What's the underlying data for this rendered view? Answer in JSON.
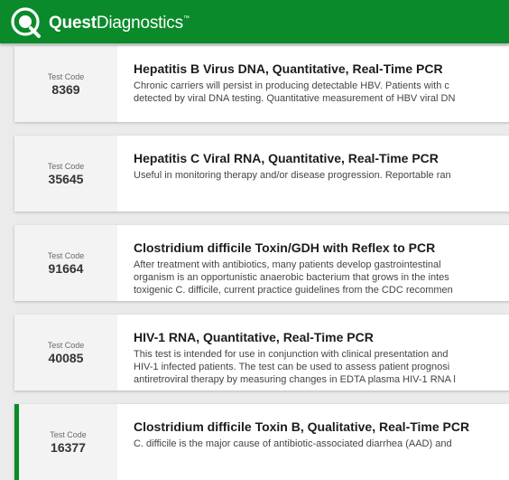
{
  "header": {
    "brand_bold": "Quest",
    "brand_light": "Diagnostics",
    "trademark": "™",
    "bg_color": "#0a8a2a"
  },
  "tests": [
    {
      "code_label": "Test Code",
      "code": "8369",
      "title": "Hepatitis B Virus DNA, Quantitative, Real-Time PCR",
      "desc_lines": [
        "Chronic carriers will persist in producing detectable HBV. Patients with c",
        "detected by viral DNA testing. Quantitative measurement of HBV viral DN"
      ]
    },
    {
      "code_label": "Test Code",
      "code": "35645",
      "title": "Hepatitis C Viral RNA, Quantitative, Real-Time PCR",
      "desc_lines": [
        "Useful in monitoring therapy and/or disease progression. Reportable ran"
      ]
    },
    {
      "code_label": "Test Code",
      "code": "91664",
      "title": "Clostridium difficile Toxin/GDH with Reflex to PCR",
      "desc_lines": [
        "After treatment with antibiotics, many patients develop gastrointestinal",
        "organism is an opportunistic anaerobic bacterium that grows in the intes",
        "toxigenic C. difficile, current practice guidelines from the CDC recommen"
      ]
    },
    {
      "code_label": "Test Code",
      "code": "40085",
      "title": "HIV-1 RNA, Quantitative, Real-Time PCR",
      "desc_lines": [
        "This test is intended for use in conjunction with clinical presentation and",
        "HIV-1 infected patients. The test can be used to assess patient prognosi",
        "antiretroviral therapy by measuring changes in EDTA plasma HIV-1 RNA l"
      ]
    },
    {
      "code_label": "Test Code",
      "code": "16377",
      "title": "Clostridium difficile Toxin B, Qualitative, Real-Time PCR",
      "desc_lines": [
        "C. difficile is the major cause of antibiotic-associated diarrhea (AAD) and"
      ],
      "active": true
    }
  ]
}
